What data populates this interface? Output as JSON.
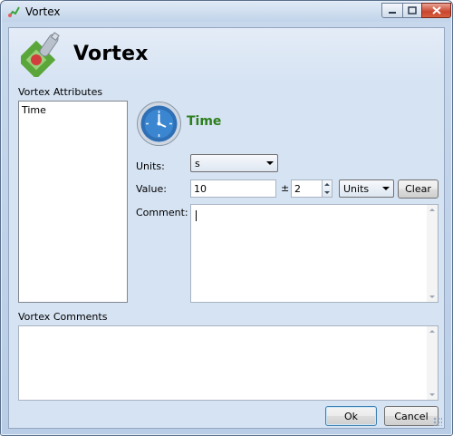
{
  "window": {
    "title": "Vortex",
    "controls": {
      "minimize": "minimize",
      "maximize": "maximize",
      "close": "close"
    }
  },
  "header": {
    "app_title": "Vortex"
  },
  "attributes": {
    "label": "Vortex Attributes",
    "items": [
      "Time"
    ]
  },
  "detail": {
    "title": "Time",
    "title_color": "#2d7f1d",
    "units_label": "Units:",
    "units_value": "s",
    "value_label": "Value:",
    "value": "10",
    "plus_minus": "±",
    "precision": "2",
    "units_dropdown": "Units",
    "clear_button": "Clear",
    "comment_label": "Comment:",
    "comment_value": ""
  },
  "comments": {
    "label": "Vortex Comments",
    "value": ""
  },
  "footer": {
    "ok_button": "Ok",
    "cancel_button": "Cancel"
  },
  "icons": {
    "app_icon": "vortex-logo-icon",
    "attribute_icon": "clock-icon"
  }
}
